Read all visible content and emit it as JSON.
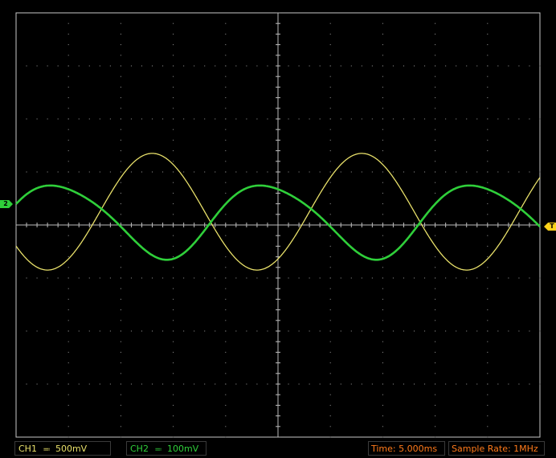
{
  "status": {
    "ch1_label": "CH1",
    "ch1_coupling_glyph": "≕",
    "ch1_scale": "500mV",
    "ch2_label": "CH2",
    "ch2_coupling_glyph": "≕",
    "ch2_scale": "100mV",
    "time": "Time: 5.000ms",
    "sample_rate": "Sample Rate: 1MHz"
  },
  "markers": {
    "ch2_level": "2",
    "trigger_level": "T"
  },
  "colors": {
    "ch1": "#e8e06a",
    "ch2": "#2fcf3a",
    "info_text": "#ff7a1a",
    "grid": "#9a9a9a",
    "border": "#c8c8c8",
    "background": "#000000"
  },
  "icons": {
    "ch2_marker": "channel-2-level-icon",
    "trigger_marker": "trigger-level-icon"
  },
  "grid": {
    "horizontal_divisions": 10,
    "vertical_divisions": 8
  },
  "waveform": {
    "ch1": {
      "period_fraction": 0.4,
      "amplitude_div": 2.2,
      "center_div": 0.5,
      "phase": 0.6
    },
    "ch2": {
      "period_fraction": 0.4,
      "amplitude_div": 1.38,
      "center_div": 0.2,
      "phase": 0.05
    }
  }
}
